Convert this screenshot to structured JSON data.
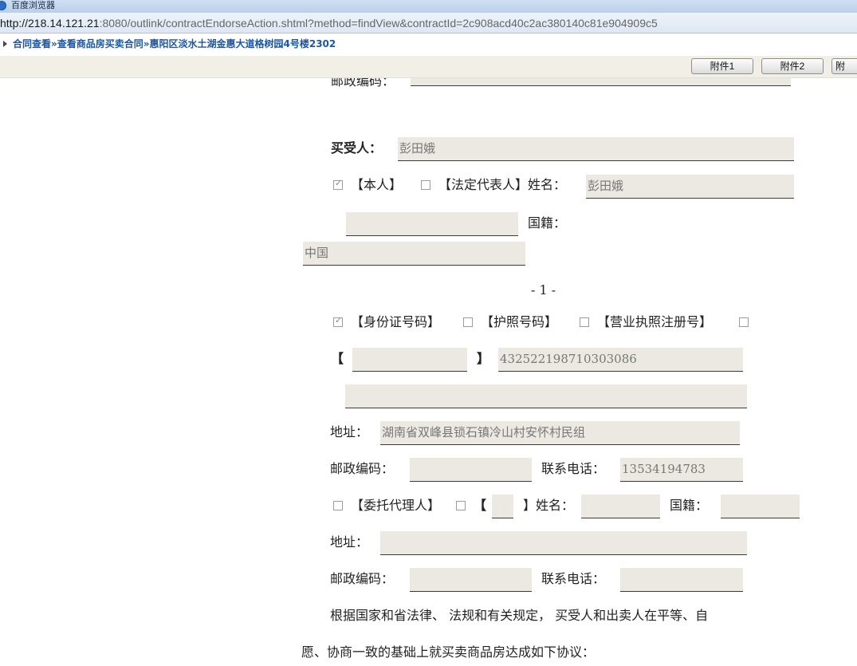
{
  "browser": {
    "title": "百度浏览器",
    "url_host": "http://218.14.121.21",
    "url_rest": ":8080/outlink/contractEndorseAction.shtml?method=findView&contractId=2c908acd40c2ac380140c81e904909c5"
  },
  "breadcrumb": "合同查看»查看商品房买卖合同»惠阳区淡水土湖金惠大道格树园4号楼2302",
  "toolbar": {
    "attach1": "附件1",
    "attach2": "附件2",
    "attach3": "附"
  },
  "doc": {
    "cut_text": "邮政编码：",
    "buyer_label": "买受人：",
    "buyer_name": "彭田娥",
    "self_label": "【本人】",
    "legal_rep_label": "【法定代表人】姓名：",
    "legal_rep_name": "彭田娥",
    "nationality_label": "国籍：",
    "nationality_value": "中国",
    "page_number": "- 1 -",
    "id_card_label": "【身份证号码】",
    "passport_label": "【护照号码】",
    "business_license_label": "【营业执照注册号】",
    "bracket_open": "【",
    "bracket_close": "】",
    "id_number": "432522198710303086",
    "address_label": "地址：",
    "address_value": "湖南省双峰县锁石镇冷山村安怀村民组",
    "postcode_label": "邮政编码：",
    "phone_label": "联系电话：",
    "phone_value": "13534194783",
    "agent_label": "【委托代理人】",
    "agent_name_label": "】姓名：",
    "agent_nationality_label": "国籍：",
    "address2_label": "地址：",
    "postcode2_label": "邮政编码：",
    "phone2_label": "联系电话：",
    "para_line1": "根据国家和省法律、 法规和有关规定， 买受人和出卖人在平等、自",
    "para_line2": "愿、协商一致的基础上就买卖商品房达成如下协议："
  }
}
